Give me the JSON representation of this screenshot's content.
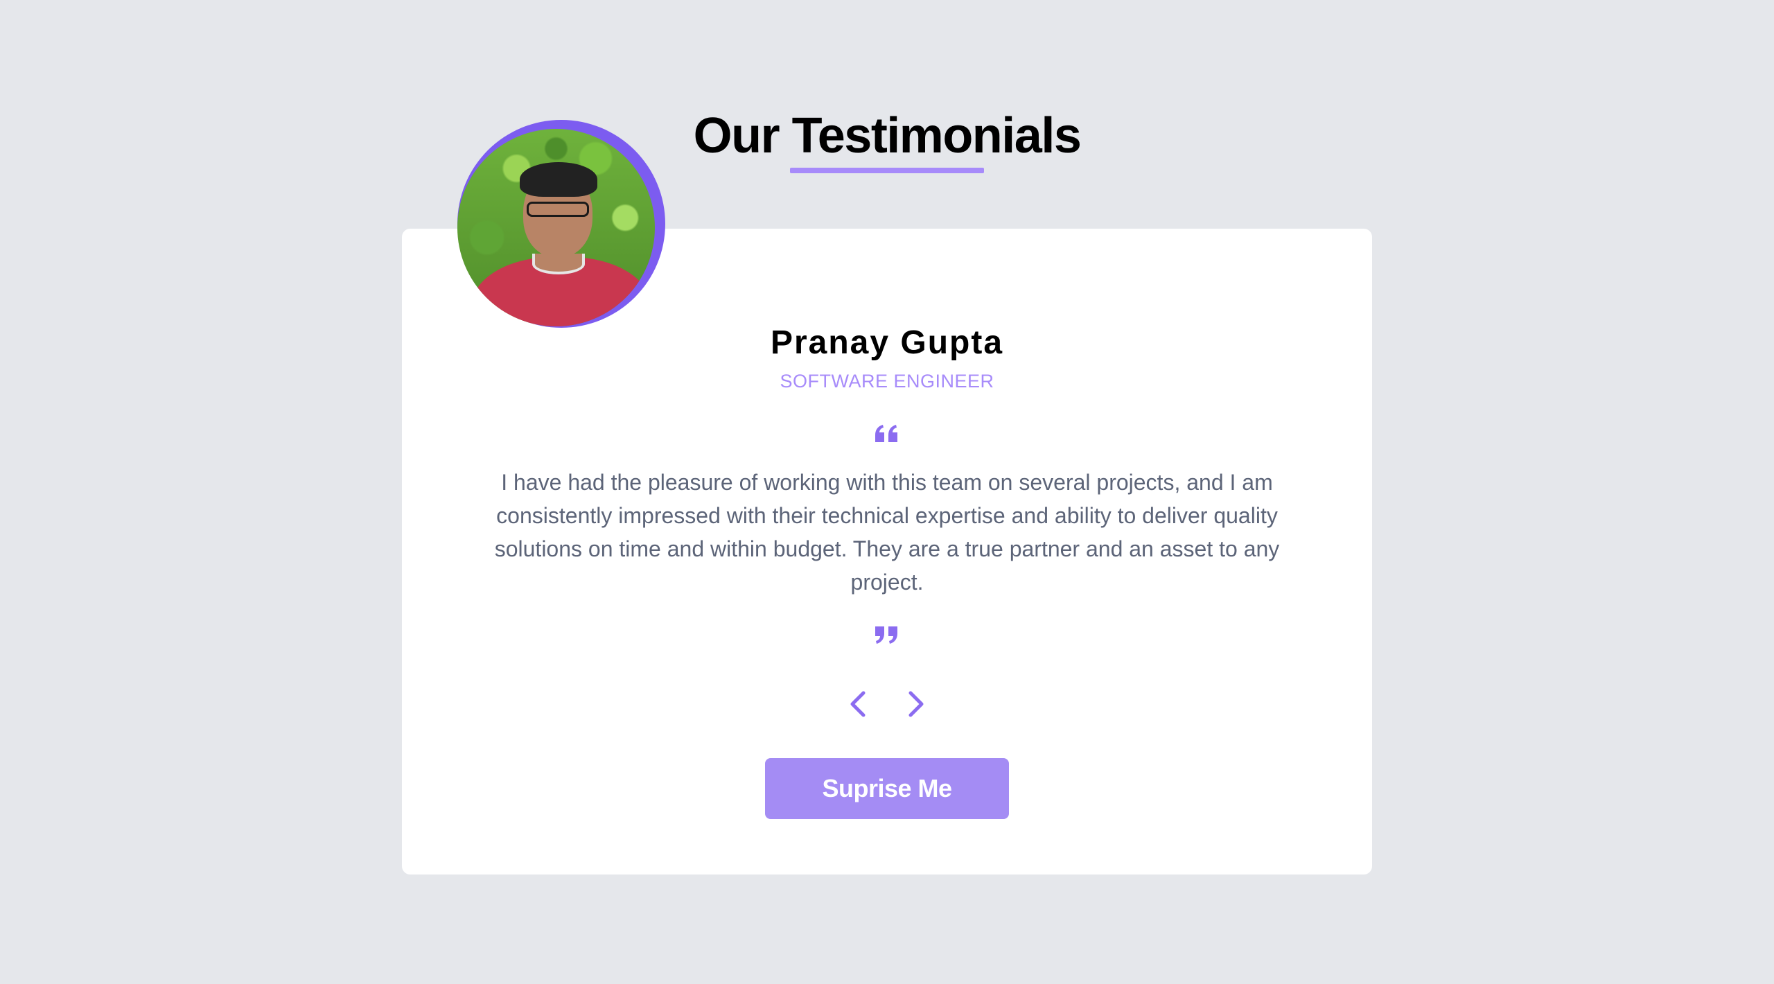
{
  "header": {
    "title": "Our Testimonials"
  },
  "testimonial": {
    "name": "Pranay Gupta",
    "role": "SOFTWARE ENGINEER",
    "text": "I have had the pleasure of working with this team on several projects, and I am consistently impressed with their technical expertise and ability to deliver quality solutions on time and within budget. They are a true partner and an asset to any project.",
    "avatar_icon": "person-photo"
  },
  "icons": {
    "quote_open": "quote-left-icon",
    "quote_close": "quote-right-icon",
    "prev": "chevron-left-icon",
    "next": "chevron-right-icon"
  },
  "actions": {
    "surprise_label": "Suprise Me"
  },
  "colors": {
    "background": "#e5e7eb",
    "accent": "#a78bfa",
    "accent_dark": "#7c5cf0",
    "text_muted": "#5c6478",
    "card": "#ffffff"
  }
}
